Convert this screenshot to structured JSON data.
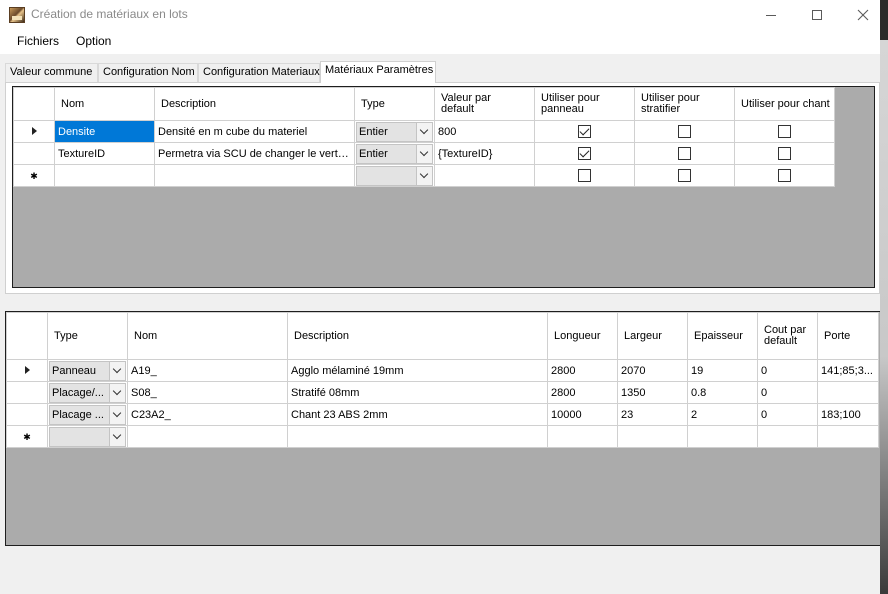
{
  "window": {
    "title": "Création de matériaux en lots"
  },
  "menu": {
    "items": [
      "Fichiers",
      "Option"
    ]
  },
  "tabs": [
    "Valeur commune",
    "Configuration Nom",
    "Configuration Materiaux",
    "Matériaux Paramètres"
  ],
  "active_tab": "Matériaux Paramètres",
  "params_grid": {
    "headers": {
      "nom": "Nom",
      "description": "Description",
      "type": "Type",
      "default_l1": "Valeur par",
      "default_l2": "default",
      "panneau_l1": "Utiliser pour",
      "panneau_l2": "panneau",
      "stratifie_l1": "Utiliser pour",
      "stratifie_l2": "stratifier",
      "chant": "Utiliser pour chant"
    },
    "rows": [
      {
        "nom": "Densite",
        "description": "Densité en m cube du materiel",
        "type": "Entier",
        "default": "800",
        "panneau": true,
        "stratifie": false,
        "chant": false
      },
      {
        "nom": "TextureID",
        "description": "Permetra via SCU de changer le vert du materiel",
        "type": "Entier",
        "default": "{TextureID}",
        "panneau": true,
        "stratifie": false,
        "chant": false
      }
    ],
    "new_row": {
      "panneau": false,
      "stratifie": false,
      "chant": false
    }
  },
  "materials_grid": {
    "headers": {
      "type": "Type",
      "nom": "Nom",
      "description": "Description",
      "longueur": "Longueur",
      "largeur": "Largeur",
      "epaisseur": "Epaisseur",
      "cout_l1": "Cout par",
      "cout_l2": "default",
      "porte": "Porte"
    },
    "rows": [
      {
        "type": "Panneau",
        "nom": "A19_",
        "description": "Agglo mélaminé 19mm",
        "longueur": "2800",
        "largeur": "2070",
        "epaisseur": "19",
        "cout": "0",
        "porte": "141;85;3..."
      },
      {
        "type": "Placage/...",
        "nom": "S08_",
        "description": "Stratifé 08mm",
        "longueur": "2800",
        "largeur": "1350",
        "epaisseur": "0.8",
        "cout": "0",
        "porte": ""
      },
      {
        "type": "Placage ...",
        "nom": "C23A2_",
        "description": "Chant 23 ABS 2mm",
        "longueur": "10000",
        "largeur": "23",
        "epaisseur": "2",
        "cout": "0",
        "porte": "183;100"
      }
    ]
  }
}
